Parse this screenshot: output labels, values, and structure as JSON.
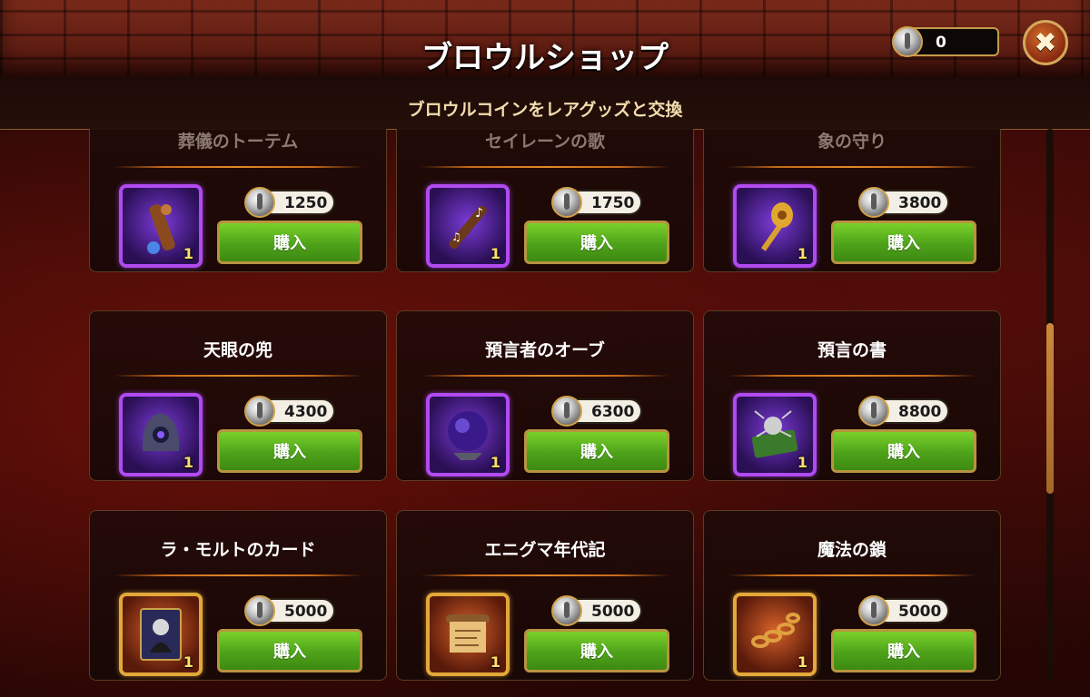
{
  "header": {
    "title": "ブロウルショップ",
    "subtitle": "ブロウルコインをレアグッズと交換",
    "coins": "0"
  },
  "buy_label": "購入",
  "items": [
    {
      "name": "葬儀のトーテム",
      "price": "1250",
      "qty": "1",
      "rarity": "epic",
      "icon": "totem-staff-icon"
    },
    {
      "name": "セイレーンの歌",
      "price": "1750",
      "qty": "1",
      "rarity": "epic",
      "icon": "siren-flute-icon"
    },
    {
      "name": "象の守り",
      "price": "3800",
      "qty": "1",
      "rarity": "epic",
      "icon": "elephant-amulet-icon"
    },
    {
      "name": "天眼の兜",
      "price": "4300",
      "qty": "1",
      "rarity": "epic",
      "icon": "eye-helmet-icon"
    },
    {
      "name": "預言者のオーブ",
      "price": "6300",
      "qty": "1",
      "rarity": "epic",
      "icon": "prophet-orb-icon"
    },
    {
      "name": "預言の書",
      "price": "8800",
      "qty": "1",
      "rarity": "epic",
      "icon": "prophecy-book-icon"
    },
    {
      "name": "ラ・モルトのカード",
      "price": "5000",
      "qty": "1",
      "rarity": "legendary",
      "icon": "death-card-icon"
    },
    {
      "name": "エニグマ年代記",
      "price": "5000",
      "qty": "1",
      "rarity": "legendary",
      "icon": "enigma-scroll-icon"
    },
    {
      "name": "魔法の鎖",
      "price": "5000",
      "qty": "1",
      "rarity": "legendary",
      "icon": "magic-chain-icon"
    }
  ],
  "colors": {
    "epic_frame": "#b14af0",
    "legendary_frame": "#e2a83a",
    "buy_button": "#4ea21a",
    "accent": "#c49a4c"
  }
}
